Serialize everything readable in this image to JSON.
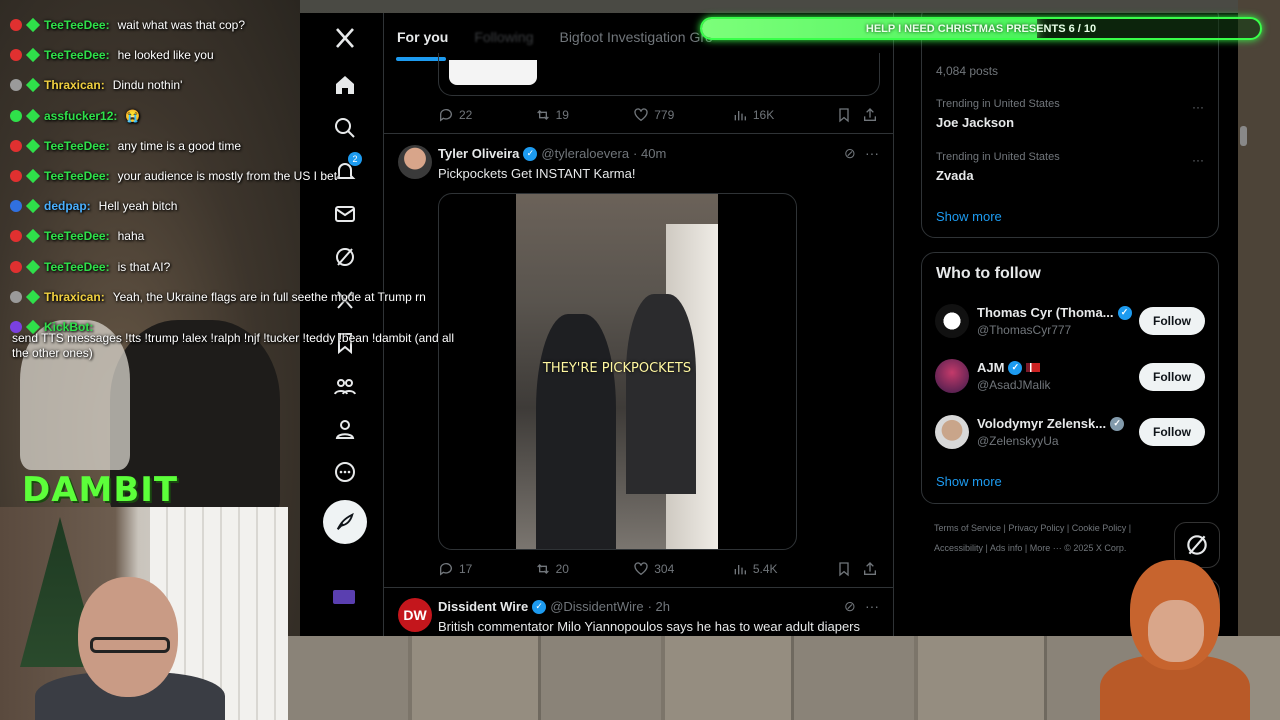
{
  "goal_bar": {
    "text": "HELP I NEED CHRISTMAS PRESENTS 6 / 10",
    "progress": 0.6
  },
  "chat": {
    "messages": [
      {
        "user": "TeeTeeDee:",
        "text": "wait what was that cop?",
        "color": "#2fe04a",
        "badge": "#e03030"
      },
      {
        "user": "TeeTeeDee:",
        "text": "he looked like you",
        "color": "#2fe04a",
        "badge": "#e03030"
      },
      {
        "user": "Thraxican:",
        "text": "Dindu nothin'",
        "color": "#f0d040",
        "badge": "#9a9a9a"
      },
      {
        "user": "assfucker12:",
        "text": "😭",
        "color": "#2fe04a",
        "badge": "#2fe04a"
      },
      {
        "user": "TeeTeeDee:",
        "text": "any time is a good time",
        "color": "#2fe04a",
        "badge": "#e03030"
      },
      {
        "user": "TeeTeeDee:",
        "text": "your audience is mostly from the US I bet",
        "color": "#2fe04a",
        "badge": "#e03030"
      },
      {
        "user": "dedpap:",
        "text": "Hell yeah bitch",
        "color": "#4ab0ff",
        "badge": "#3070e0"
      },
      {
        "user": "TeeTeeDee:",
        "text": "haha",
        "color": "#2fe04a",
        "badge": "#e03030"
      },
      {
        "user": "TeeTeeDee:",
        "text": "is that AI?",
        "color": "#2fe04a",
        "badge": "#e03030"
      },
      {
        "user": "Thraxican:",
        "text": "Yeah, the Ukraine flags are in full seethe mode at Trump rn",
        "color": "#f0d040",
        "badge": "#9a9a9a"
      },
      {
        "user": "KickBot:",
        "text": "",
        "color": "#2fe04a",
        "badge": "#7a40e0"
      }
    ],
    "kickbot_text": "send TTS messages !tts !trump !alex !ralph !njf !tucker !teddy !bean !dambit (and all the other ones)",
    "brand": "DAMBIT"
  },
  "x": {
    "tabs": [
      "For you",
      "Following",
      "Bigfoot Investigation Gro"
    ],
    "nav": [
      "x-logo-icon",
      "home-icon",
      "search-icon",
      "notifications-icon",
      "messages-icon",
      "grok-icon",
      "premium-icon",
      "bookmarks-icon",
      "communities-icon",
      "profile-icon",
      "more-icon"
    ],
    "notif_count": "2",
    "top_tweet_stats": {
      "replies": "22",
      "reposts": "19",
      "likes": "779",
      "views": "16K"
    },
    "tweet1": {
      "name": "Tyler Oliveira",
      "handle": "@tyleraloevera",
      "time": "· 40m",
      "text": "Pickpockets Get INSTANT Karma!",
      "video_caption": "THEY'RE PICKPOCKETS",
      "stats": {
        "replies": "17",
        "reposts": "20",
        "likes": "304",
        "views": "5.4K"
      }
    },
    "tweet2": {
      "name": "Dissident Wire",
      "handle": "@DissidentWire",
      "time": "· 2h",
      "text": "British commentator Milo Yiannopoulos says he has to wear adult diapers",
      "avatar_text": "DW"
    },
    "trends": {
      "top_count": "4,084 posts",
      "items": [
        {
          "meta": "Trending in United States",
          "name": "Joe Jackson"
        },
        {
          "meta": "Trending in United States",
          "name": "Zvada"
        }
      ],
      "show_more": "Show more"
    },
    "who_to_follow": {
      "title": "Who to follow",
      "users": [
        {
          "name": "Thomas Cyr (Thoma...",
          "handle": "@ThomasCyr777",
          "button": "Follow"
        },
        {
          "name": "AJM",
          "handle": "@AsadJMalik",
          "button": "Follow"
        },
        {
          "name": "Volodymyr Zelensk...",
          "handle": "@ZelenskyyUa",
          "button": "Follow"
        }
      ],
      "show_more": "Show more"
    },
    "footer": {
      "line1": "Terms of Service  |  Privacy Policy  |  Cookie Policy  |",
      "line2": "Accessibility  |  Ads info  |  More ···  © 2025 X Corp."
    }
  }
}
